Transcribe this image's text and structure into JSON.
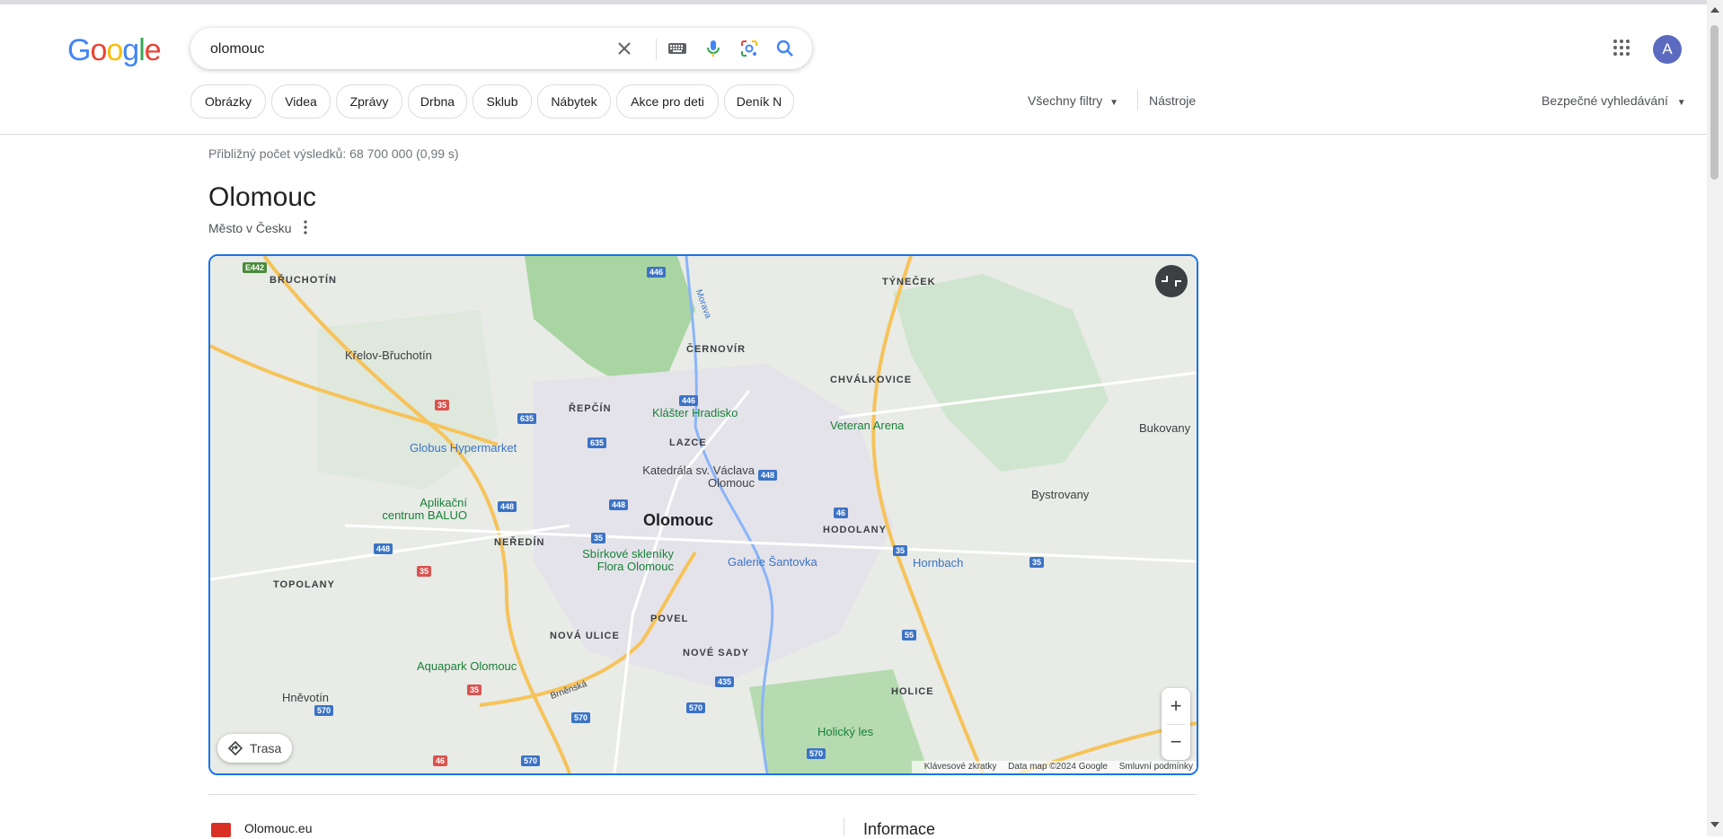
{
  "header": {
    "logo_letters": [
      {
        "ch": "G",
        "color": "#4285F4"
      },
      {
        "ch": "o",
        "color": "#EA4335"
      },
      {
        "ch": "o",
        "color": "#FBBC05"
      },
      {
        "ch": "g",
        "color": "#4285F4"
      },
      {
        "ch": "l",
        "color": "#34A853"
      },
      {
        "ch": "e",
        "color": "#EA4335"
      }
    ],
    "search_value": "olomouc",
    "avatar_letter": "A"
  },
  "chips": [
    "Obrázky",
    "Videa",
    "Zprávy",
    "Drbna",
    "Sklub",
    "Nábytek",
    "Akce pro deti",
    "Deník N"
  ],
  "toolbar": {
    "filters_label": "Všechny filtry",
    "tools_label": "Nástroje",
    "safe_search_label": "Bezpečné vyhledávání"
  },
  "results": {
    "stats": "Přibližný počet výsledků: 68 700 000 (0,99 s)"
  },
  "knowledge": {
    "title": "Olomouc",
    "subtitle": "Město v Česku"
  },
  "map": {
    "city_label": "Olomouc",
    "districts": [
      "BŘUCHOTÍN",
      "TÝNEČEK",
      "ČERNOVÍR",
      "CHVÁLKOVICE",
      "ŘEPČÍN",
      "LAZCE",
      "HODOLANY",
      "NEŘEDÍN",
      "TOPOLANY",
      "POVEL",
      "NOVÁ ULICE",
      "NOVÉ SADY",
      "HOLICE"
    ],
    "places": [
      "Křelov-Břuchotín",
      "Bukovany",
      "Bystrovany",
      "Hněvotín"
    ],
    "pois": [
      "Klášter Hradisko",
      "Veteran Arena",
      "Globus Hypermarket",
      "Katedrála sv. Václava Olomouc",
      "Aplikační centrum BALUO",
      "Sbírkové skleníky Flora Olomouc",
      "Galerie Šantovka",
      "Hornbach",
      "Aquapark Olomouc",
      "Holický les"
    ],
    "road_badges": [
      "E442",
      "446",
      "446",
      "635",
      "635",
      "35",
      "448",
      "448",
      "448",
      "448",
      "46",
      "35",
      "35",
      "35",
      "35",
      "435",
      "570",
      "570",
      "570",
      "570",
      "55",
      "35",
      "46",
      "570"
    ],
    "street": "Brněnská",
    "river": "Morava",
    "route_button": "Trasa",
    "attribution": {
      "shortcuts": "Klávesové zkratky",
      "data": "Data map ©2024 Google",
      "terms": "Smluvní podmínky"
    }
  },
  "first_result": {
    "site_name": "Olomouc.eu"
  },
  "side_panel": {
    "heading": "Informace"
  }
}
